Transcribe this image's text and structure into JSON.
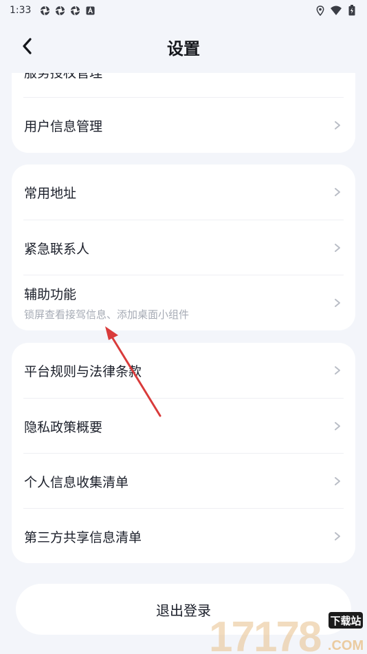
{
  "status_bar": {
    "time": "1:33",
    "left_icons": [
      "aperture-icon",
      "aperture-icon",
      "aperture-icon",
      "a-badge-icon"
    ],
    "right_icons": [
      "location-icon",
      "wifi-icon",
      "battery-icon"
    ]
  },
  "nav": {
    "title": "设置",
    "back_icon": "chevron-left-icon"
  },
  "card1": {
    "partial_item": "服务授权管理",
    "items": [
      {
        "label": "用户信息管理"
      }
    ]
  },
  "card2": {
    "items": [
      {
        "label": "常用地址"
      },
      {
        "label": "紧急联系人"
      },
      {
        "label": "辅助功能",
        "subtitle": "锁屏查看接驾信息、添加桌面小组件"
      }
    ]
  },
  "card3": {
    "items": [
      {
        "label": "平台规则与法律条款"
      },
      {
        "label": "隐私政策概要"
      },
      {
        "label": "个人信息收集清单"
      },
      {
        "label": "第三方共享信息清单"
      }
    ]
  },
  "logout": {
    "label": "退出登录"
  },
  "annotation": {
    "arrow_color": "#d93b3b"
  },
  "watermark": {
    "brand": "17178",
    "domain": ".COM",
    "badge": "下载站"
  },
  "colors": {
    "background": "#f3f5fa",
    "card": "#ffffff",
    "text": "#1b1f2a",
    "subtext": "#a6abb5",
    "chevron": "#b9bdc6"
  }
}
